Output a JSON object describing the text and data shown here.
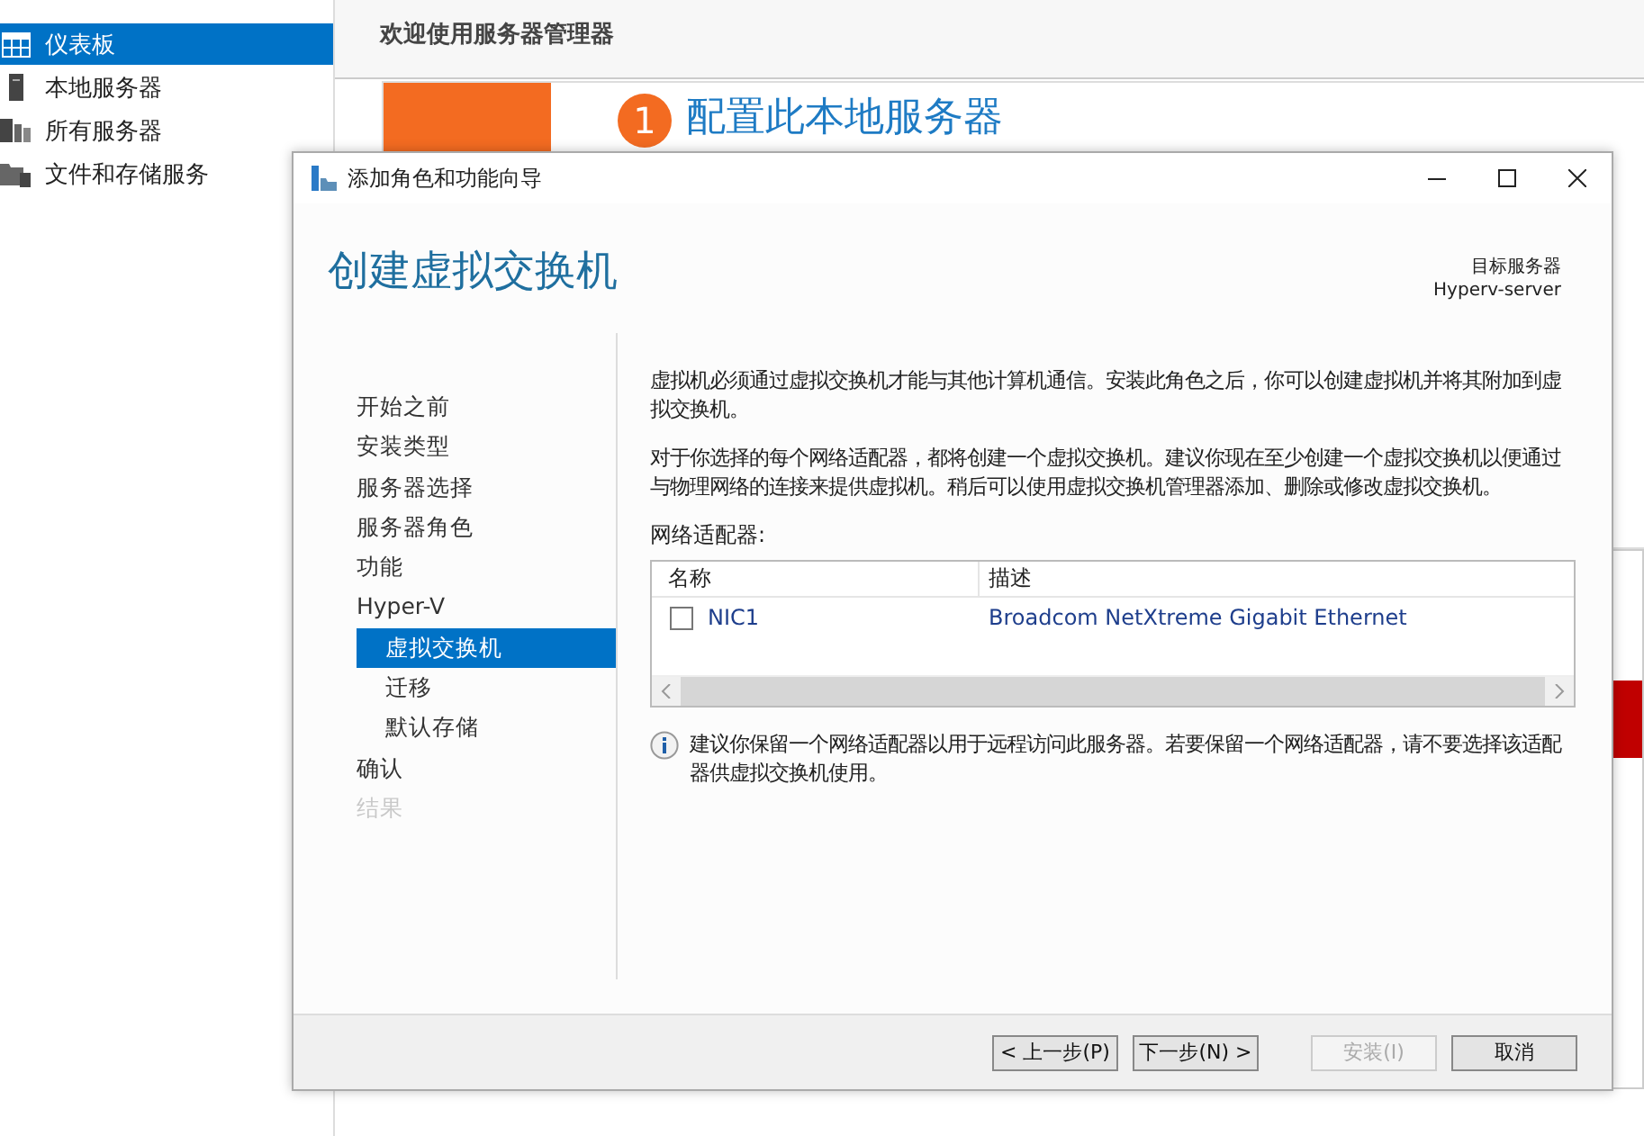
{
  "sidebar": {
    "items": [
      {
        "label": "仪表板",
        "selected": true
      },
      {
        "label": "本地服务器",
        "selected": false
      },
      {
        "label": "所有服务器",
        "selected": false
      },
      {
        "label": "文件和存储服务",
        "selected": false
      }
    ]
  },
  "main": {
    "title": "欢迎使用服务器管理器",
    "quick_start": {
      "step": "1",
      "heading": "配置此本地服务器"
    }
  },
  "dialog": {
    "title": "添加角色和功能向导",
    "heading": "创建虚拟交换机",
    "target_label": "目标服务器",
    "target_server": "Hyperv-server",
    "steps": [
      {
        "label": "开始之前",
        "selected": false,
        "disabled": false
      },
      {
        "label": "安装类型",
        "selected": false,
        "disabled": false
      },
      {
        "label": "服务器选择",
        "selected": false,
        "disabled": false
      },
      {
        "label": "服务器角色",
        "selected": false,
        "disabled": false
      },
      {
        "label": "功能",
        "selected": false,
        "disabled": false
      },
      {
        "label": "Hyper-V",
        "selected": false,
        "disabled": false,
        "children": [
          {
            "label": "虚拟交换机",
            "selected": true,
            "disabled": false
          },
          {
            "label": "迁移",
            "selected": false,
            "disabled": false
          },
          {
            "label": "默认存储",
            "selected": false,
            "disabled": false
          }
        ]
      },
      {
        "label": "确认",
        "selected": false,
        "disabled": false
      },
      {
        "label": "结果",
        "selected": false,
        "disabled": true
      }
    ],
    "paragraphs": [
      "虚拟机必须通过虚拟交换机才能与其他计算机通信。安装此角色之后，你可以创建虚拟机并将其附加到虚拟交换机。",
      "对于你选择的每个网络适配器，都将创建一个虚拟交换机。建议你现在至少创建一个虚拟交换机以便通过与物理网络的连接来提供虚拟机。稍后可以使用虚拟交换机管理器添加、删除或修改虚拟交换机。"
    ],
    "adapters_label": "网络适配器:",
    "adapters_table": {
      "columns": [
        "名称",
        "描述"
      ],
      "rows": [
        {
          "name": "NIC1",
          "description": "Broadcom NetXtreme Gigabit Ethernet",
          "checked": false
        }
      ]
    },
    "note": "建议你保留一个网络适配器以用于远程访问此服务器。若要保留一个网络适配器，请不要选择该适配器供虚拟交换机使用。",
    "buttons": [
      {
        "label": "< 上一步(P)",
        "disabled": false
      },
      {
        "label": "下一步(N) >",
        "disabled": false
      },
      {
        "label": "安装(I)",
        "disabled": true
      },
      {
        "label": "取消",
        "disabled": false
      }
    ]
  }
}
